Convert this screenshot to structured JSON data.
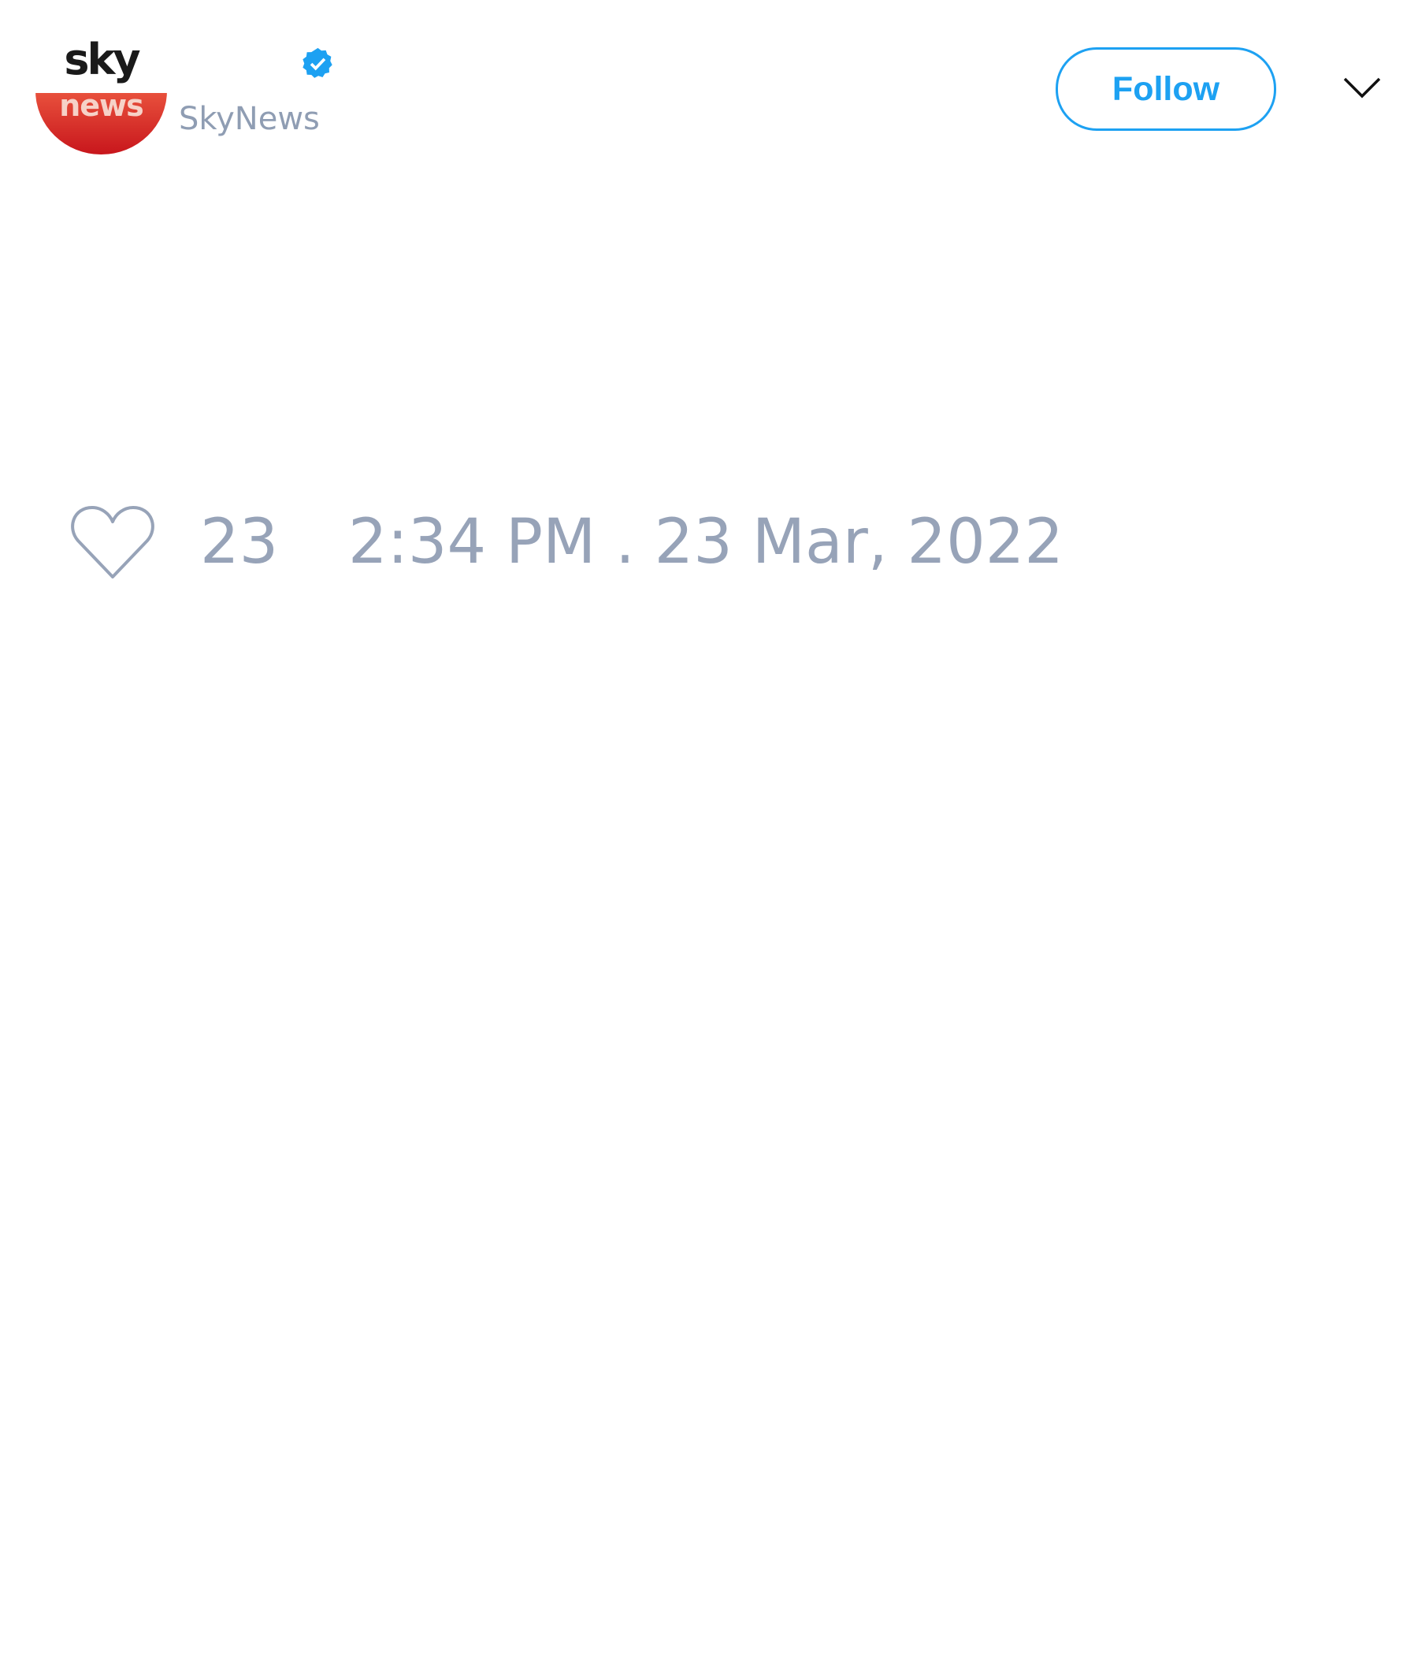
{
  "header": {
    "avatar_logo_text": {
      "top": "sky",
      "bottom": "news"
    },
    "display_name": "",
    "handle": "SkyNews",
    "verified_icon": "verified-badge-icon",
    "follow_label": "Follow",
    "menu_icon": "chevron-down-icon"
  },
  "footer": {
    "like_icon": "heart-icon",
    "like_count": "23",
    "timestamp": "2:34 PM . 23 Mar, 2022"
  },
  "colors": {
    "accent": "#1da1f2",
    "muted_text": "#97a3b8",
    "brand_red": "#d42a24"
  }
}
